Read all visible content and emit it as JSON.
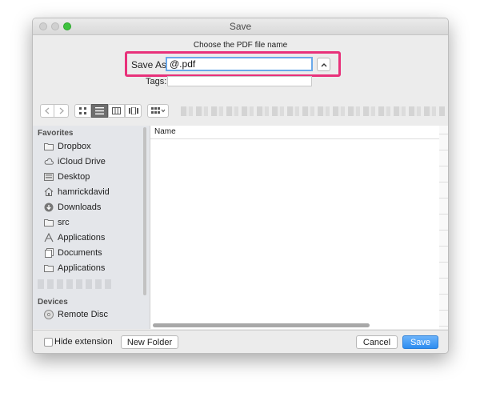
{
  "window": {
    "title": "Save"
  },
  "dialog": {
    "subtitle": "Choose the PDF file name",
    "save_as_label": "Save As:",
    "save_as_value": "@.pdf",
    "tags_label": "Tags:",
    "tags_value": ""
  },
  "sidebar": {
    "favorites_header": "Favorites",
    "favorites": [
      {
        "label": "Dropbox",
        "icon": "folder-icon"
      },
      {
        "label": "iCloud Drive",
        "icon": "cloud-icon"
      },
      {
        "label": "Desktop",
        "icon": "desktop-icon"
      },
      {
        "label": "hamrickdavid",
        "icon": "home-icon"
      },
      {
        "label": "Downloads",
        "icon": "download-icon"
      },
      {
        "label": "src",
        "icon": "folder-icon"
      },
      {
        "label": "Applications",
        "icon": "applications-icon"
      },
      {
        "label": "Documents",
        "icon": "documents-icon"
      },
      {
        "label": "Applications",
        "icon": "folder-icon"
      }
    ],
    "devices_header": "Devices",
    "devices": [
      {
        "label": "Remote Disc",
        "icon": "disc-icon"
      }
    ]
  },
  "filelist": {
    "column_name": "Name"
  },
  "bottom": {
    "hide_extension_label": "Hide extension",
    "new_folder_label": "New Folder",
    "cancel_label": "Cancel",
    "save_label": "Save"
  },
  "colors": {
    "highlight": "#e8317a",
    "accent": "#2d8cf0",
    "zoom_button": "#3ec23e"
  }
}
